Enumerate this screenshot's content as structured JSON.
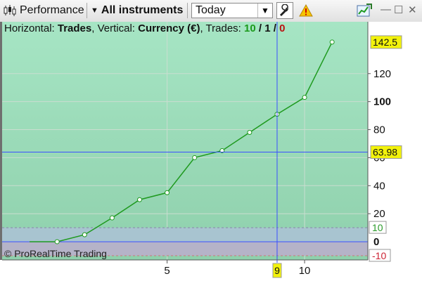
{
  "toolbar": {
    "performance_label": "Performance",
    "instruments_label": "All instruments",
    "period_value": "Today",
    "chart_icon": "candlestick-icon",
    "wrench_icon": "wrench-icon",
    "warning_icon": "warning-icon",
    "export_icon": "chart-export-icon"
  },
  "info": {
    "h_prefix": "Horizontal:",
    "h_value": "Trades",
    "v_prefix": ", Vertical:",
    "v_value": "Currency (€)",
    "trades_prefix": ", Trades:",
    "trades_win": "10",
    "slash1": " / ",
    "trades_neutral": "1",
    "slash2": " / ",
    "trades_loss": "0"
  },
  "copyright": "© ProRealTime Trading",
  "cursor": {
    "x_value": "9",
    "y_value": "63.98"
  },
  "last_value": "142.5",
  "band_labels": {
    "upper": "10",
    "lower": "-10"
  },
  "colors": {
    "line": "#1f9a1f",
    "area_top": "#a6e5c4",
    "band": "#a8c4d0",
    "crosshair": "#3a4fff",
    "tag_bg": "#f2f20b"
  },
  "chart_data": {
    "type": "line",
    "xlabel": "",
    "ylabel": "",
    "xlim": [
      -1,
      12.3
    ],
    "ylim": [
      -13,
      157
    ],
    "x": [
      0,
      1,
      2,
      3,
      4,
      5,
      6,
      7,
      8,
      9,
      10,
      11
    ],
    "series": [
      {
        "values": [
          0,
          0,
          5,
          17,
          30,
          35,
          60,
          65,
          78,
          91,
          103,
          142.5
        ]
      }
    ],
    "y_ticks": [
      "20",
      "40",
      "60",
      "80",
      "100",
      "120"
    ],
    "x_ticks": [
      "5",
      "10"
    ],
    "x_tick_values": [
      5,
      10
    ],
    "band": [
      -10,
      10
    ]
  }
}
